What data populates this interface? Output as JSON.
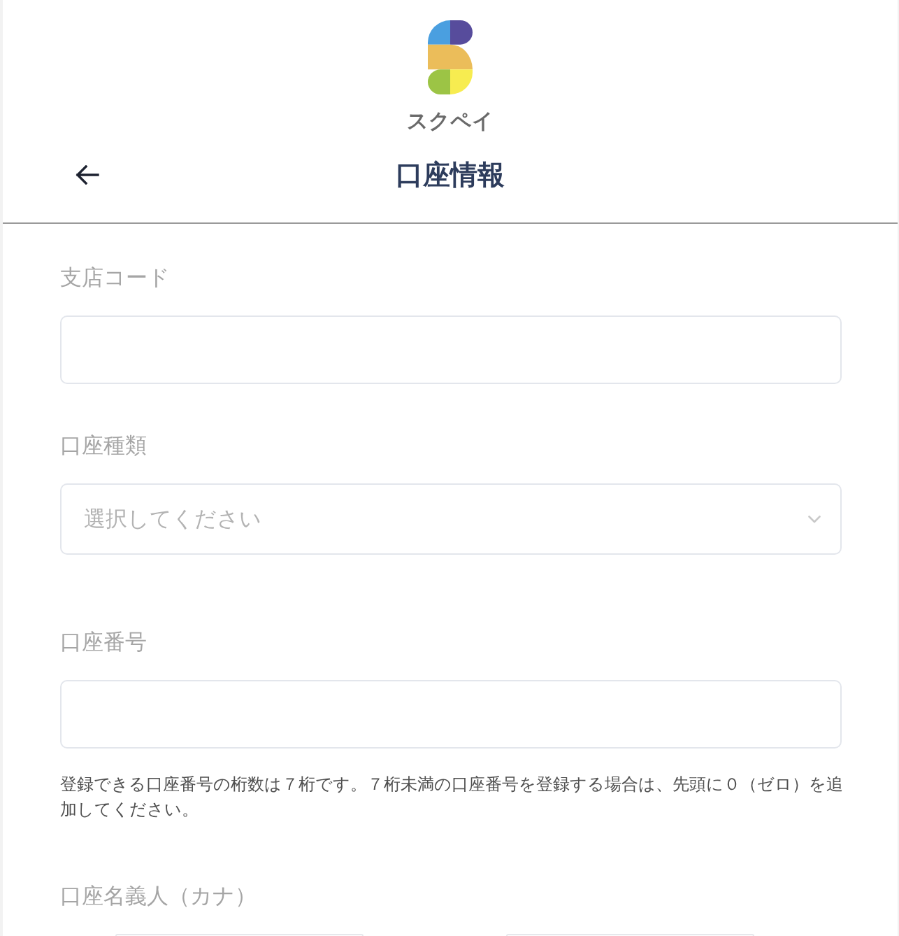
{
  "logo": {
    "wordmark": "スクペイ"
  },
  "header": {
    "title": "口座情報"
  },
  "fields": [
    {
      "kind": "text",
      "label": "支店コード"
    },
    {
      "kind": "select",
      "label": "口座種類",
      "placeholder": "選択してください"
    },
    {
      "kind": "text",
      "label": "口座番号",
      "help": "登録できる口座番号の桁数は７桁です。７桁未満の口座番号を登録する場合は、先頭に０（ゼロ）を追加してください。"
    },
    {
      "kind": "pair",
      "label": "口座名義人（カナ）"
    }
  ]
}
